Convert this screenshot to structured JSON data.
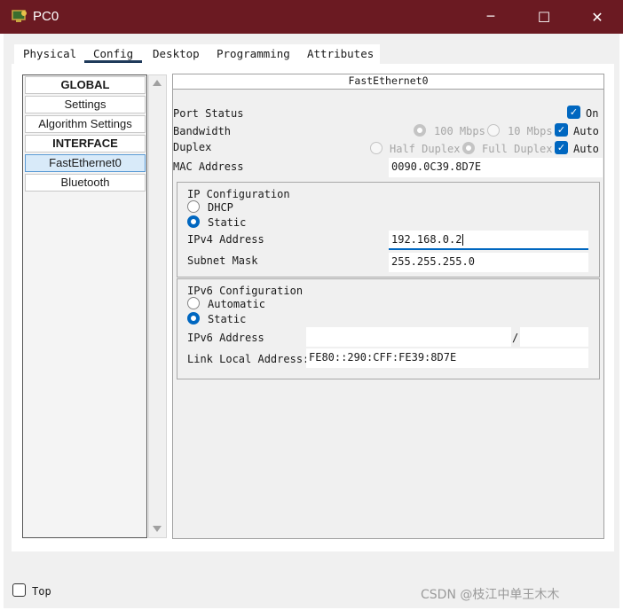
{
  "window": {
    "title": "PC0"
  },
  "tabs": [
    {
      "label": "Physical"
    },
    {
      "label": "Config"
    },
    {
      "label": "Desktop"
    },
    {
      "label": "Programming"
    },
    {
      "label": "Attributes"
    }
  ],
  "sidebar": {
    "items": [
      {
        "label": "GLOBAL"
      },
      {
        "label": "Settings"
      },
      {
        "label": "Algorithm Settings"
      },
      {
        "label": "INTERFACE"
      },
      {
        "label": "FastEthernet0"
      },
      {
        "label": "Bluetooth"
      }
    ]
  },
  "panel": {
    "title": "FastEthernet0",
    "port_status": {
      "label": "Port Status",
      "on_label": "On",
      "checked": true
    },
    "bandwidth": {
      "label": "Bandwidth",
      "opt1": "100 Mbps",
      "opt2": "10 Mbps",
      "auto_label": "Auto"
    },
    "duplex": {
      "label": "Duplex",
      "opt1": "Half Duplex",
      "opt2": "Full Duplex",
      "auto_label": "Auto"
    },
    "mac": {
      "label": "MAC Address",
      "value": "0090.0C39.8D7E"
    },
    "ipv4": {
      "title": "IP Configuration",
      "dhcp_label": "DHCP",
      "static_label": "Static",
      "address_label": "IPv4 Address",
      "address_value": "192.168.0.2",
      "mask_label": "Subnet Mask",
      "mask_value": "255.255.255.0"
    },
    "ipv6": {
      "title": "IPv6 Configuration",
      "automatic_label": "Automatic",
      "static_label": "Static",
      "address_label": "IPv6 Address",
      "address_value": "",
      "prefix_sep": "/",
      "prefix_value": "",
      "link_local_label": "Link Local Address:",
      "link_local_value": "FE80::290:CFF:FE39:8D7E"
    }
  },
  "footer": {
    "top_label": "Top"
  },
  "watermark": "CSDN @枝江中单王木木",
  "icons": {
    "check": "✓",
    "minimize": "─",
    "maximize": "☐",
    "close": "✕"
  },
  "colors": {
    "titlebar": "#6b1a22",
    "accent": "#0067c0",
    "selected_item": "#d8eaf9"
  }
}
